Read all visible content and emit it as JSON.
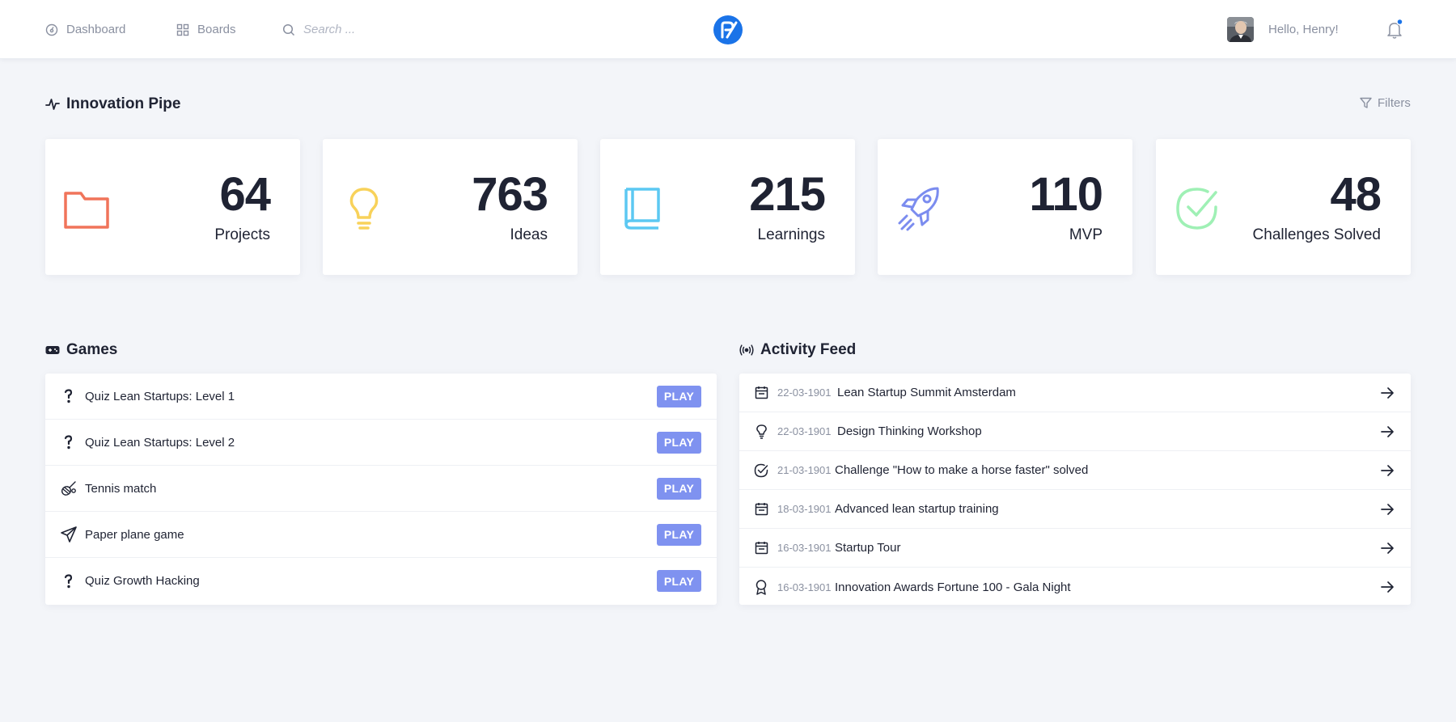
{
  "nav": {
    "dashboard_label": "Dashboard",
    "boards_label": "Boards",
    "search_placeholder": "Search ..."
  },
  "user": {
    "greeting": "Hello, Henry!"
  },
  "pipe": {
    "title": "Innovation Pipe",
    "filters_label": "Filters",
    "stats": [
      {
        "value": "64",
        "label": "Projects",
        "icon": "folder-icon",
        "color": "#f0745a"
      },
      {
        "value": "763",
        "label": "Ideas",
        "icon": "lightbulb-icon",
        "color": "#f8d25a"
      },
      {
        "value": "215",
        "label": "Learnings",
        "icon": "book-icon",
        "color": "#5cc8f2"
      },
      {
        "value": "110",
        "label": "MVP",
        "icon": "rocket-icon",
        "color": "#7b8cef"
      },
      {
        "value": "48",
        "label": "Challenges Solved",
        "icon": "check-circle-icon",
        "color": "#9ff0b5"
      }
    ]
  },
  "games": {
    "title": "Games",
    "play_label": "PLAY",
    "items": [
      {
        "label": "Quiz Lean Startups: Level 1",
        "icon": "question-icon"
      },
      {
        "label": "Quiz Lean Startups: Level 2",
        "icon": "question-icon"
      },
      {
        "label": "Tennis match",
        "icon": "tennis-icon"
      },
      {
        "label": "Paper plane game",
        "icon": "paper-plane-icon"
      },
      {
        "label": "Quiz Growth Hacking",
        "icon": "question-icon"
      }
    ]
  },
  "feed": {
    "title": "Activity Feed",
    "items": [
      {
        "date": "22-03-1901",
        "text": "Lean Startup Summit Amsterdam",
        "icon": "calendar-icon"
      },
      {
        "date": "22-03-1901",
        "text": "Design Thinking Workshop",
        "icon": "lightbulb-icon"
      },
      {
        "date": "21-03-1901",
        "text": "Challenge \"How to make a horse faster\" solved",
        "icon": "check-circle-icon"
      },
      {
        "date": "18-03-1901",
        "text": "Advanced lean startup training",
        "icon": "calendar-icon"
      },
      {
        "date": "16-03-1901",
        "text": "Startup Tour",
        "icon": "calendar-icon"
      },
      {
        "date": "16-03-1901",
        "text": "Innovation Awards Fortune 100 - Gala Night",
        "icon": "award-icon"
      }
    ]
  },
  "colors": {
    "accent": "#7f92f0",
    "brand": "#1a73e8",
    "notification_dot": "#1a73e8"
  }
}
